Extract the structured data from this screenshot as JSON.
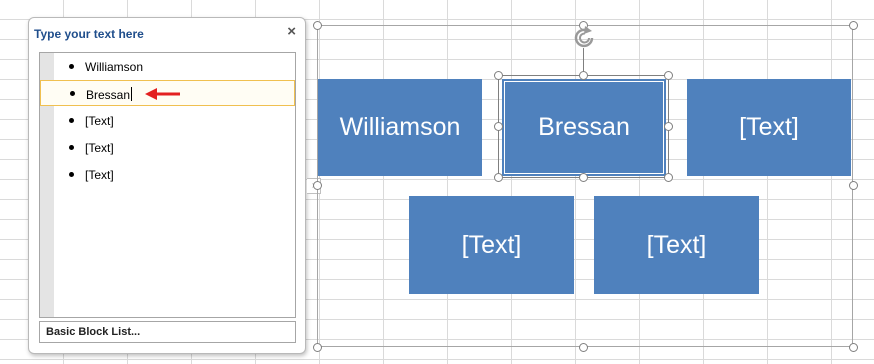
{
  "text_pane": {
    "title": "Type your text here",
    "close_glyph": "×",
    "items": [
      {
        "text": "Williamson"
      },
      {
        "text": "Bressan",
        "active": true
      },
      {
        "text": "[Text]"
      },
      {
        "text": "[Text]"
      },
      {
        "text": "[Text]"
      }
    ],
    "layout_name": "Basic Block List...",
    "expand_glyph": "›"
  },
  "smartart": {
    "blocks": [
      {
        "label": "Williamson"
      },
      {
        "label": "Bressan",
        "selected": true
      },
      {
        "label": "[Text]"
      },
      {
        "label": "[Text]"
      },
      {
        "label": "[Text]"
      }
    ],
    "block_color": "#4f81bd"
  },
  "colors": {
    "pane_title": "#1f4e8c",
    "arrow": "#e32020",
    "active_item_border": "#f0c050"
  },
  "icons": [
    "close-icon",
    "arrow-left-icon",
    "rotate-icon",
    "expand-pane-icon"
  ]
}
